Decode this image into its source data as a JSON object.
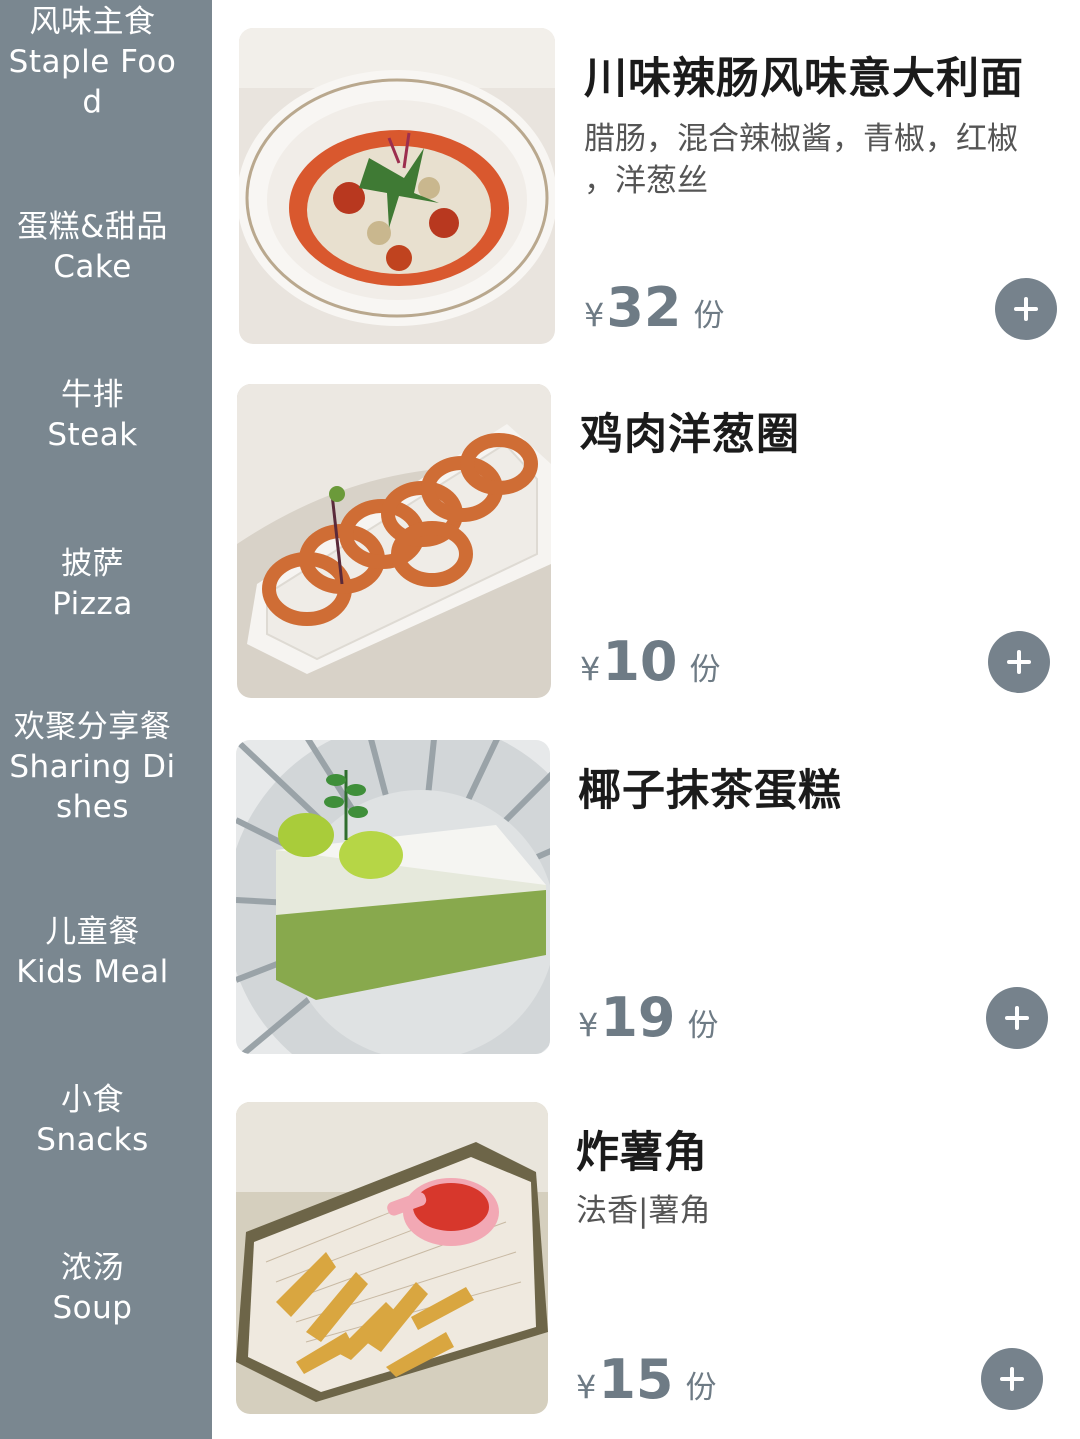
{
  "sidebar": {
    "categories": [
      {
        "zh": "风味主食",
        "en1": "Staple Foo",
        "en2": "d"
      },
      {
        "zh": "蛋糕&甜品",
        "en1": "Cake",
        "en2": ""
      },
      {
        "zh": "牛排",
        "en1": "Steak",
        "en2": ""
      },
      {
        "zh": "披萨",
        "en1": "Pizza",
        "en2": ""
      },
      {
        "zh": "欢聚分享餐",
        "en1": "Sharing Di",
        "en2": "shes"
      },
      {
        "zh": "儿童餐",
        "en1": "Kids Meal",
        "en2": ""
      },
      {
        "zh": "小食",
        "en1": "Snacks",
        "en2": ""
      },
      {
        "zh": "浓汤",
        "en1": "Soup",
        "en2": ""
      }
    ]
  },
  "items": [
    {
      "name": "川味辣肠风味意大利面",
      "desc_line1": "腊肠，混合辣椒酱，青椒，红椒",
      "desc_line2": "，洋葱丝",
      "currency": "¥",
      "price": "32",
      "unit": "份"
    },
    {
      "name": "鸡肉洋葱圈",
      "desc_line1": "",
      "desc_line2": "",
      "currency": "¥",
      "price": "10",
      "unit": "份"
    },
    {
      "name": "椰子抹茶蛋糕",
      "desc_line1": "",
      "desc_line2": "",
      "currency": "¥",
      "price": "19",
      "unit": "份"
    },
    {
      "name": "炸薯角",
      "desc_line1": "法香|薯角",
      "desc_line2": "",
      "currency": "¥",
      "price": "15",
      "unit": "份"
    }
  ]
}
